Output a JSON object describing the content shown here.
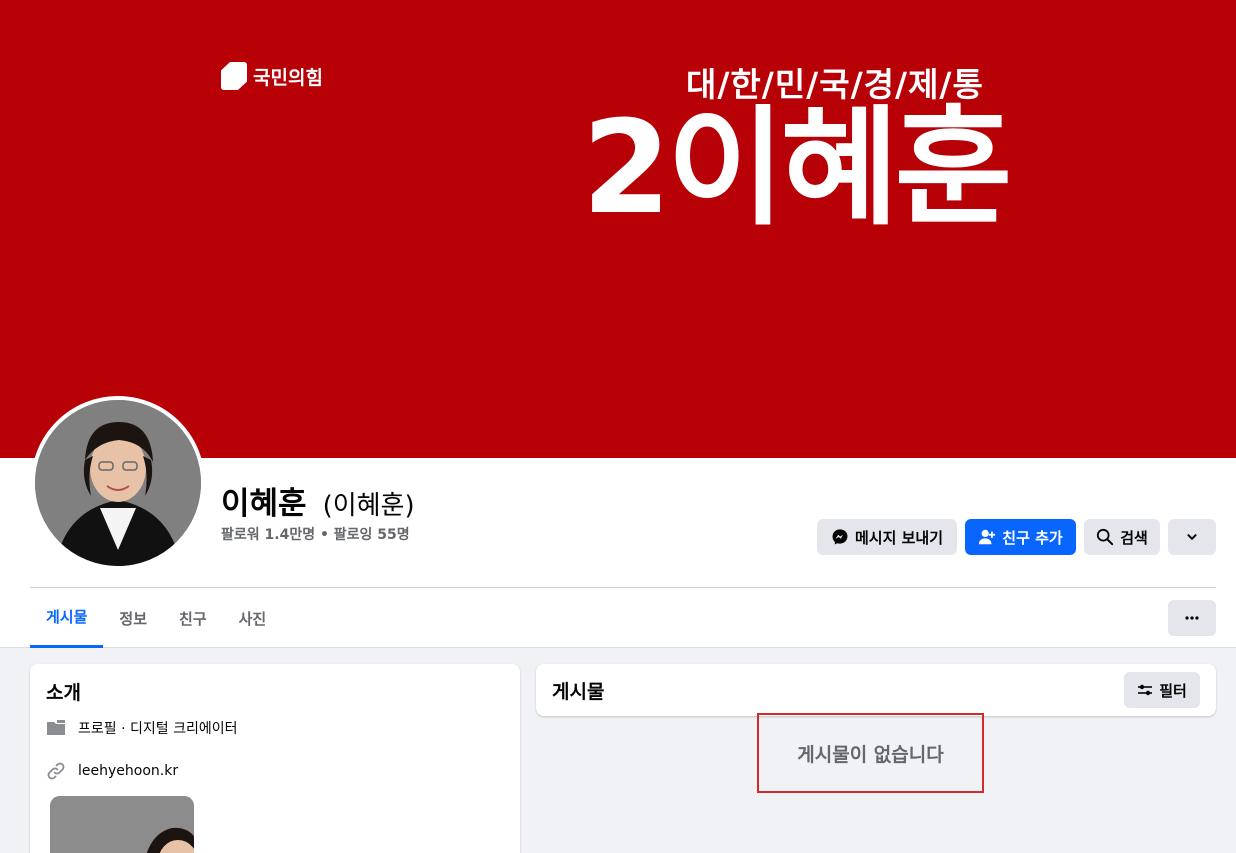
{
  "cover": {
    "party_logo": "국민의힘",
    "slogan": "대/한/민/국/경/제/통",
    "headline": "2이혜훈",
    "color": "#b80007"
  },
  "profile": {
    "name": "이혜훈",
    "alternate_name": "(이혜훈)",
    "follow_info": "팔로워 1.4만명 • 팔로잉 55명"
  },
  "actions": {
    "message": "메시지 보내기",
    "add_friend": "친구 추가",
    "search": "검색"
  },
  "tabs": [
    "게시물",
    "정보",
    "친구",
    "사진"
  ],
  "intro": {
    "title": "소개",
    "category": "프로필 · 디지털 크리에이터",
    "website": "leehyehoon.kr"
  },
  "posts": {
    "title": "게시물",
    "filter": "필터",
    "empty": "게시물이 없습니다"
  },
  "colors": {
    "accent": "#0866ff",
    "highlight_border": "#d42a2a"
  }
}
